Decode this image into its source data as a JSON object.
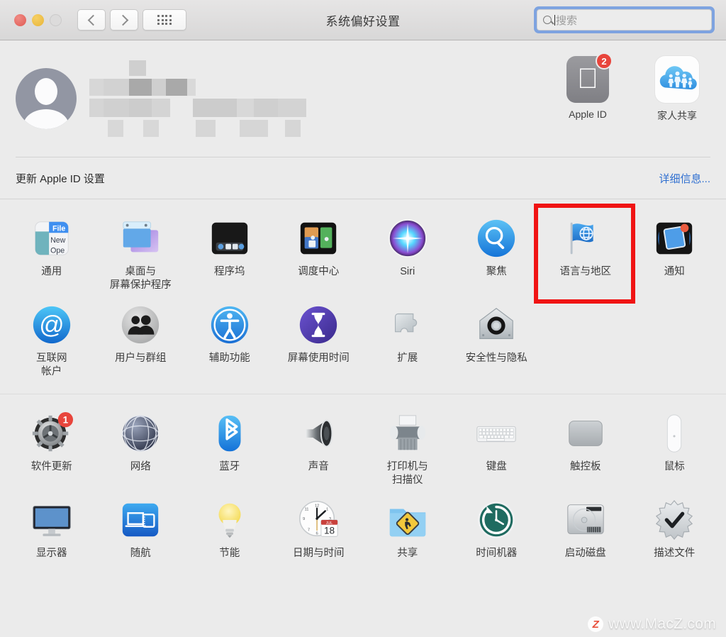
{
  "window": {
    "title": "系统偏好设置",
    "traffic_lights": [
      "close",
      "minimize",
      "zoom"
    ],
    "nav": {
      "back": "back-chevron",
      "forward": "forward-chevron",
      "show_all": "grid-dots"
    }
  },
  "search": {
    "placeholder": "搜索",
    "value": "",
    "icon": "search-icon",
    "focused": true
  },
  "apple_id_panel": {
    "avatar": "user-avatar-placeholder",
    "name_redacted": true,
    "buttons": [
      {
        "label": "Apple ID",
        "icon": "apple-logo-icon",
        "badge": "2"
      },
      {
        "label": "家人共享",
        "icon": "family-sharing-cloud-icon",
        "badge": ""
      }
    ],
    "update_notice": "更新 Apple ID 设置",
    "details_link": "详细信息..."
  },
  "grid": {
    "section1": [
      {
        "label": "通用",
        "icon": "general-icon"
      },
      {
        "label": "桌面与\n屏幕保护程序",
        "icon": "desktop-screensaver-icon"
      },
      {
        "label": "程序坞",
        "icon": "dock-icon"
      },
      {
        "label": "调度中心",
        "icon": "mission-control-icon"
      },
      {
        "label": "Siri",
        "icon": "siri-icon"
      },
      {
        "label": "聚焦",
        "icon": "spotlight-icon"
      },
      {
        "label": "语言与地区",
        "icon": "language-region-flag-icon",
        "highlighted": true
      },
      {
        "label": "通知",
        "icon": "notifications-icon"
      },
      {
        "label": "互联网\n帐户",
        "icon": "internet-accounts-at-icon"
      },
      {
        "label": "用户与群组",
        "icon": "users-groups-icon"
      },
      {
        "label": "辅助功能",
        "icon": "accessibility-icon"
      },
      {
        "label": "屏幕使用时间",
        "icon": "screen-time-hourglass-icon"
      },
      {
        "label": "扩展",
        "icon": "extensions-puzzle-icon"
      },
      {
        "label": "安全性与隐私",
        "icon": "security-privacy-house-icon"
      }
    ],
    "section2": [
      {
        "label": "软件更新",
        "icon": "software-update-gear-icon",
        "badge": "1"
      },
      {
        "label": "网络",
        "icon": "network-globe-icon"
      },
      {
        "label": "蓝牙",
        "icon": "bluetooth-icon"
      },
      {
        "label": "声音",
        "icon": "sound-speaker-icon"
      },
      {
        "label": "打印机与\n扫描仪",
        "icon": "printers-scanners-icon"
      },
      {
        "label": "键盘",
        "icon": "keyboard-icon"
      },
      {
        "label": "触控板",
        "icon": "trackpad-icon"
      },
      {
        "label": "鼠标",
        "icon": "mouse-icon"
      },
      {
        "label": "显示器",
        "icon": "displays-monitor-icon"
      },
      {
        "label": "随航",
        "icon": "sidecar-icon"
      },
      {
        "label": "节能",
        "icon": "energy-saver-bulb-icon"
      },
      {
        "label": "日期与时间",
        "icon": "date-time-clock-icon"
      },
      {
        "label": "共享",
        "icon": "sharing-folder-icon"
      },
      {
        "label": "时间机器",
        "icon": "time-machine-icon"
      },
      {
        "label": "启动磁盘",
        "icon": "startup-disk-icon"
      },
      {
        "label": "描述文件",
        "icon": "profiles-checkmark-icon"
      }
    ]
  },
  "watermark": {
    "mark": "Z",
    "text": "www.MacZ.com"
  },
  "colors": {
    "highlight": "#f01414",
    "badge_red": "#e8453c",
    "link_blue": "#2f6fd0",
    "window_bg": "#ebebeb",
    "titlebar": "#dedddd",
    "search_focus_ring": "#7ea3e0"
  }
}
